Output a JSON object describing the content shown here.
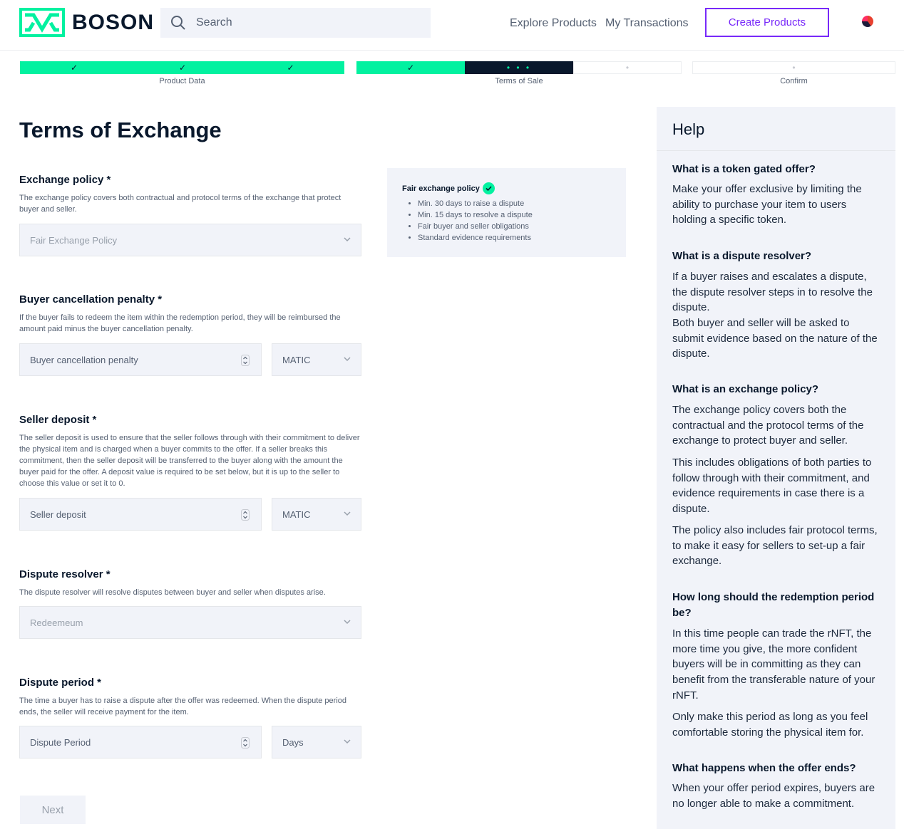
{
  "header": {
    "brand": "BOSON",
    "search_placeholder": "Search",
    "nav": [
      "Explore Products",
      "My Transactions"
    ],
    "create_label": "Create Products"
  },
  "stepper": {
    "done_mark": "✓",
    "active_mark": "• • •",
    "todo_mark": "•",
    "labels": [
      "Product Data",
      "Terms of Sale",
      "Confirm"
    ]
  },
  "form": {
    "title": "Terms of Exchange",
    "exchange_policy": {
      "title": "Exchange policy *",
      "desc": "The exchange policy covers both contractual and protocol terms of the exchange that protect buyer and seller.",
      "value": "Fair Exchange Policy"
    },
    "policy_card": {
      "title": "Fair exchange policy",
      "items": [
        "Min. 30 days to raise a dispute",
        "Min. 15 days to resolve a dispute",
        "Fair buyer and seller obligations",
        "Standard evidence requirements"
      ]
    },
    "buyer_penalty": {
      "title": "Buyer cancellation penalty *",
      "desc": "If the buyer fails to redeem the item within the redemption period, they will be reimbursed the amount paid minus the buyer cancellation penalty.",
      "placeholder": "Buyer cancellation penalty",
      "unit": "MATIC"
    },
    "seller_deposit": {
      "title": "Seller deposit *",
      "desc": "The seller deposit is used to ensure that the seller follows through with their commitment to deliver the physical item and is charged when a buyer commits to the offer. If a seller breaks this commitment, then the seller deposit will be transferred to the buyer along with the amount the buyer paid for the offer. A deposit value is required to be set below, but it is up to the seller to choose this value or set it to 0.",
      "placeholder": "Seller deposit",
      "unit": "MATIC"
    },
    "dispute_resolver": {
      "title": "Dispute resolver *",
      "desc": "The dispute resolver will resolve disputes between buyer and seller when disputes arise.",
      "value": "Redeemeum"
    },
    "dispute_period": {
      "title": "Dispute period *",
      "desc": "The time a buyer has to raise a dispute after the offer was redeemed. When the dispute period ends, the seller will receive payment for the item.",
      "placeholder": "Dispute Period",
      "unit": "Days"
    },
    "next_label": "Next"
  },
  "help": {
    "title": "Help",
    "q1": "What is a token gated offer?",
    "a1": "Make your offer exclusive by limiting the ability to purchase your item to users holding a specific token.",
    "q2": "What is a dispute resolver?",
    "a2a": "If a buyer raises and escalates a dispute, the dispute resolver steps in to resolve the dispute.",
    "a2b": "Both buyer and seller will be asked to submit evidence based on the nature of the dispute.",
    "q3": "What is an exchange policy?",
    "a3a": "The exchange policy covers both the contractual and the protocol terms of the exchange to protect buyer and seller.",
    "a3b": "This includes obligations of both parties to follow through with their commitment, and evidence requirements in case there is a dispute.",
    "a3c": "The policy also includes fair protocol terms, to make it easy for sellers to set-up a fair exchange.",
    "q4": "How long should the redemption period be?",
    "a4a": "In this time people can trade the rNFT, the more time you give, the more confident buyers will be in committing as they can benefit from the transferable nature of your rNFT.",
    "a4b": "Only make this period as long as you feel comfortable storing the physical item for.",
    "q5": "What happens when the offer ends?",
    "a5": "When your offer period expires, buyers are no longer able to make a commitment."
  },
  "colors": {
    "accent": "#02f1a0",
    "dark": "#09182c",
    "purple": "#7829f9",
    "panel": "#f1f3f9"
  }
}
